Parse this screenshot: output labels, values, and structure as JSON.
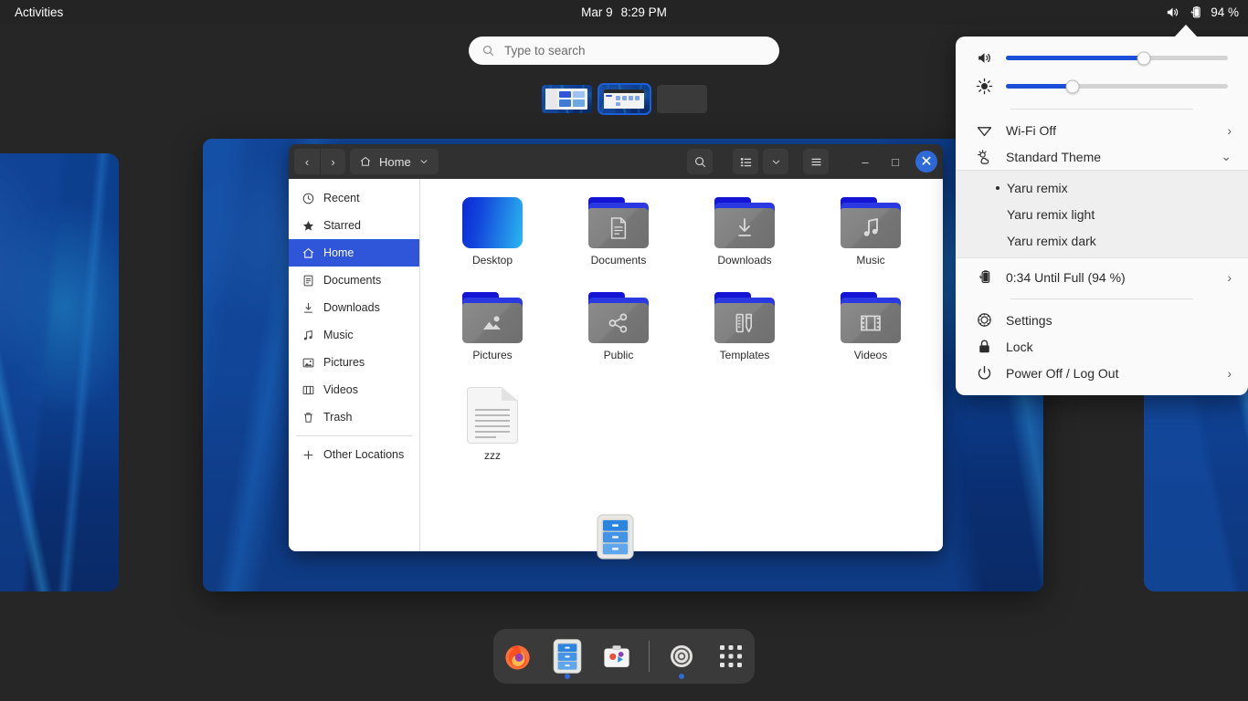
{
  "panel": {
    "activities": "Activities",
    "clock_date": "Mar 9",
    "clock_time": "8:29 PM",
    "battery_percent": "94 %",
    "volume_icon": "volume-high-icon",
    "battery_icon": "battery-charging-icon"
  },
  "overview": {
    "search": {
      "placeholder": "Type to search",
      "icon": "search-icon"
    },
    "workspaces": [
      {
        "name": "workspace-1",
        "active": false
      },
      {
        "name": "workspace-2",
        "active": true
      },
      {
        "name": "workspace-3",
        "active": false
      }
    ]
  },
  "files_window": {
    "title": "Home",
    "nav": {
      "back": "‹",
      "forward": "›"
    },
    "path_label": "Home",
    "path_icon": "home-icon",
    "search_icon": "search-icon",
    "view_list_icon": "view-list-icon",
    "view_dropdown_icon": "chevron-down-icon",
    "menu_icon": "hamburger-menu-icon",
    "window_controls": {
      "minimize": "–",
      "maximize": "□",
      "close": "✕"
    },
    "sidebar": [
      {
        "label": "Recent",
        "icon": "clock-icon",
        "active": false
      },
      {
        "label": "Starred",
        "icon": "star-icon",
        "active": false
      },
      {
        "label": "Home",
        "icon": "home-icon",
        "active": true
      },
      {
        "label": "Documents",
        "icon": "document-icon",
        "active": false
      },
      {
        "label": "Downloads",
        "icon": "download-icon",
        "active": false
      },
      {
        "label": "Music",
        "icon": "music-note-icon",
        "active": false
      },
      {
        "label": "Pictures",
        "icon": "image-icon",
        "active": false
      },
      {
        "label": "Videos",
        "icon": "film-icon",
        "active": false
      },
      {
        "label": "Trash",
        "icon": "trash-icon",
        "active": false
      }
    ],
    "sidebar_other": {
      "label": "Other Locations",
      "icon": "plus-icon"
    },
    "files": [
      {
        "label": "Desktop",
        "kind": "desktop"
      },
      {
        "label": "Documents",
        "kind": "folder",
        "glyph": "document-icon"
      },
      {
        "label": "Downloads",
        "kind": "folder",
        "glyph": "download-icon"
      },
      {
        "label": "Music",
        "kind": "folder",
        "glyph": "music-note-icon"
      },
      {
        "label": "Pictures",
        "kind": "folder",
        "glyph": "image-icon"
      },
      {
        "label": "Public",
        "kind": "folder",
        "glyph": "share-icon"
      },
      {
        "label": "Templates",
        "kind": "folder",
        "glyph": "ruler-pencil-icon"
      },
      {
        "label": "Videos",
        "kind": "folder",
        "glyph": "film-icon"
      },
      {
        "label": "zzz",
        "kind": "document"
      }
    ],
    "drag_item": "files-app-icon"
  },
  "dock": {
    "items": [
      {
        "name": "firefox",
        "running": false
      },
      {
        "name": "files",
        "running": true
      },
      {
        "name": "ubuntu-software",
        "running": false
      },
      {
        "name": "settings",
        "running": true
      },
      {
        "name": "show-applications",
        "running": false
      }
    ]
  },
  "system_menu": {
    "volume": {
      "icon": "volume-high-icon",
      "value": 62
    },
    "brightness": {
      "icon": "brightness-icon",
      "value": 30
    },
    "wifi": {
      "label": "Wi-Fi Off",
      "icon": "wifi-icon",
      "chevron": "›"
    },
    "theme": {
      "label": "Standard Theme",
      "icon": "theme-icon",
      "chevron": "⌄"
    },
    "theme_options": [
      {
        "label": "Yaru remix",
        "selected": true
      },
      {
        "label": "Yaru remix light",
        "selected": false
      },
      {
        "label": "Yaru remix dark",
        "selected": false
      }
    ],
    "battery": {
      "label": "0:34 Until Full (94 %)",
      "icon": "battery-charging-icon",
      "chevron": "›"
    },
    "settings": {
      "label": "Settings",
      "icon": "gear-icon"
    },
    "lock": {
      "label": "Lock",
      "icon": "lock-icon"
    },
    "power": {
      "label": "Power Off / Log Out",
      "icon": "power-icon",
      "chevron": "›"
    }
  },
  "colors": {
    "accent_blue": "#2f56d9",
    "slider_blue": "#1b4fd8",
    "panel_bg": "#242424",
    "overview_bg": "#262626",
    "menu_bg": "#fafafa",
    "submenu_bg": "#efefef"
  }
}
